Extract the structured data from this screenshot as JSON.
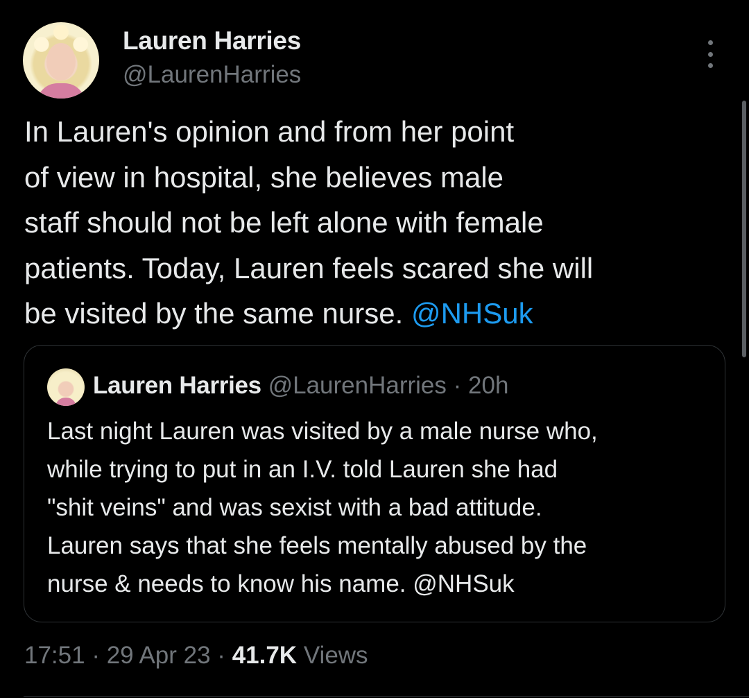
{
  "author": {
    "name": "Lauren Harries",
    "handle": "@LaurenHarries"
  },
  "tweet": {
    "lines": [
      "In Lauren's opinion and from her point",
      "of view in hospital, she believes male",
      "staff should not be left alone with female",
      "patients. Today, Lauren feels scared she will",
      "be visited by the same nurse."
    ],
    "mention": "@NHSuk"
  },
  "quoted_tweet": {
    "name": "Lauren Harries",
    "handle": "@LaurenHarries",
    "separator": "·",
    "time": "20h",
    "lines": [
      "Last night Lauren was visited by a male nurse who,",
      "while trying to put in an I.V. told Lauren she had",
      "\"shit veins\" and was sexist with a bad attitude.",
      "Lauren says that she feels mentally abused by the",
      "nurse & needs to know his name. @NHSuk"
    ]
  },
  "meta": {
    "time": "17:51",
    "separator": "·",
    "date": "29 Apr 23",
    "views_count": "41.7K",
    "views_label": "Views"
  },
  "icons": {
    "more": "more-vertical-icon"
  },
  "colors": {
    "background": "#000000",
    "text": "#e7e9ea",
    "muted": "#71767b",
    "link": "#1d9bf0",
    "border": "#2f3336"
  }
}
